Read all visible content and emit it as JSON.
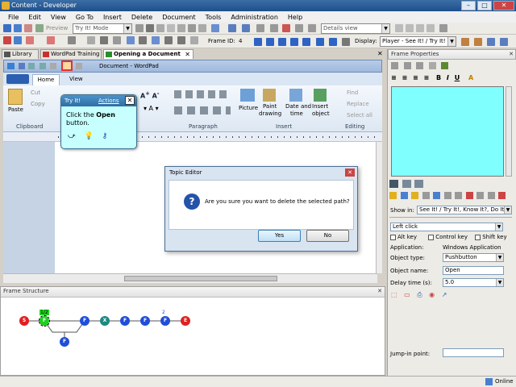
{
  "window": {
    "title": "Content - Developer"
  },
  "menu": [
    "File",
    "Edit",
    "View",
    "Go To",
    "Insert",
    "Delete",
    "Document",
    "Tools",
    "Administration",
    "Help"
  ],
  "toolbar": {
    "preview_label": "Preview",
    "mode_value": "Try It! Mode",
    "view_value": "Details view",
    "frame_id_label": "Frame ID:",
    "frame_id_value": "4",
    "display_label": "Display:",
    "display_value": "Player - See It! / Try It!"
  },
  "doc_tabs": [
    {
      "label": "Library"
    },
    {
      "label": "WordPad Training"
    },
    {
      "label": "Opening a Document"
    }
  ],
  "wordpad": {
    "caption": "Document - WordPad",
    "tabs": [
      "Home",
      "View"
    ],
    "groups": {
      "clipboard": "Clipboard",
      "paragraph": "Paragraph",
      "insert": "Insert",
      "editing": "Editing"
    },
    "clipboard": {
      "paste": "Paste",
      "cut": "Cut",
      "copy": "Copy"
    },
    "insert": {
      "picture": "Picture",
      "paint1": "Paint",
      "paint2": "drawing",
      "date1": "Date and",
      "date2": "time",
      "obj1": "Insert",
      "obj2": "object"
    },
    "editing": {
      "find": "Find",
      "replace": "Replace",
      "select_all": "Select all"
    }
  },
  "tryit": {
    "title": "Try It!",
    "actions": "Actions",
    "text_pre": "Click the ",
    "text_bold": "Open",
    "text_post": "button."
  },
  "topic_editor": {
    "title": "Topic Editor",
    "message": "Are you sure you want to delete the selected path?",
    "yes": "Yes",
    "no": "No"
  },
  "frame_properties": {
    "title": "Frame Properties",
    "show_in_label": "Show in:",
    "show_in_value": "See It! / Try It!, Know It?, Do It!",
    "action_value": "Left click",
    "alt_key": "Alt key",
    "control_key": "Control key",
    "shift_key": "Shift key",
    "application_label": "Application:",
    "application_value": "Windows Application",
    "object_type_label": "Object type:",
    "object_type_value": "Pushbutton",
    "object_name_label": "Object name:",
    "object_name_value": "Open",
    "delay_label": "Delay time (s):",
    "delay_value": "5.0",
    "jump_label": "Jump-in point:"
  },
  "frame_structure": {
    "title": "Frame Structure",
    "label_top": "1/2",
    "label_two": "2",
    "nodes": [
      {
        "t": "S",
        "c": "#e02020"
      },
      {
        "t": "F",
        "c": "#20d020"
      },
      {
        "t": "F",
        "c": "#1f4fd8"
      },
      {
        "t": "X",
        "c": "#1a8a80"
      },
      {
        "t": "F",
        "c": "#1f4fd8"
      },
      {
        "t": "F",
        "c": "#1f4fd8"
      },
      {
        "t": "F",
        "c": "#1f4fd8"
      },
      {
        "t": "E",
        "c": "#e02020"
      },
      {
        "t": "F",
        "c": "#1f4fd8"
      }
    ]
  },
  "status": {
    "online": "Online"
  },
  "colors": {
    "accent": "#2d6ea5",
    "cyan": "#80ffff"
  }
}
